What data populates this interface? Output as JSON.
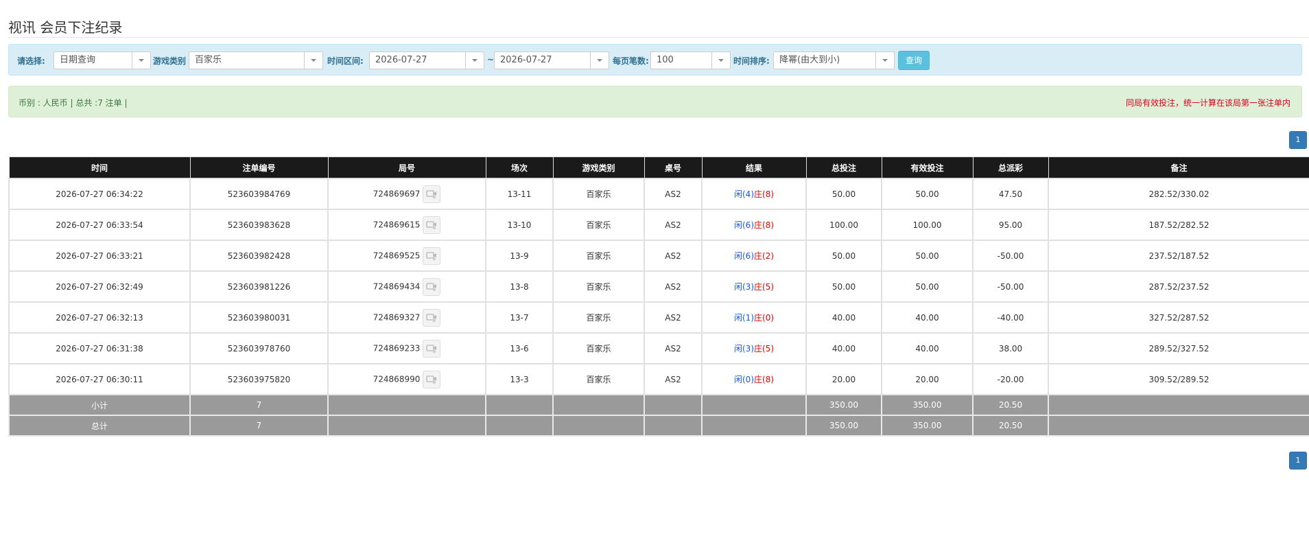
{
  "page": {
    "title": "视讯 会员下注纪录"
  },
  "filters": {
    "select_label": "请选择:",
    "select_value": "日期查询",
    "game_type_label": "游戏类别",
    "game_type_value": "百家乐",
    "time_range_label": "时间区间:",
    "date_from": "2026-07-27",
    "tilde": "~",
    "date_to": "2026-07-27",
    "per_page_label": "每页笔数:",
    "per_page_value": "100",
    "sort_label": "时间排序:",
    "sort_value": "降幂(由大到小)",
    "query_button": "查询"
  },
  "summary": {
    "left": "币别 : 人民币 | 总共 :7 注单 |",
    "right": "同局有效投注，统一计算在该局第一张注单内"
  },
  "pagination": {
    "current": "1"
  },
  "table": {
    "headers": [
      "时间",
      "注单编号",
      "局号",
      "场次",
      "游戏类别",
      "桌号",
      "结果",
      "总投注",
      "有效投注",
      "总派彩",
      "备注"
    ],
    "rows": [
      {
        "time": "2026-07-27 06:34:22",
        "bet_id": "523603984769",
        "round": "724869697",
        "shoe": "13-11",
        "game": "百家乐",
        "table": "AS2",
        "xian": "闲",
        "xian_pts": "(4)",
        "zhuang": "庄",
        "zhuang_pts": "(8)",
        "total_bet": "50.00",
        "valid_bet": "50.00",
        "payout": "47.50",
        "payout_color": "normal",
        "note": "282.52/330.02"
      },
      {
        "time": "2026-07-27 06:33:54",
        "bet_id": "523603983628",
        "round": "724869615",
        "shoe": "13-10",
        "game": "百家乐",
        "table": "AS2",
        "xian": "闲",
        "xian_pts": "(6)",
        "zhuang": "庄",
        "zhuang_pts": "(8)",
        "total_bet": "100.00",
        "valid_bet": "100.00",
        "payout": "95.00",
        "payout_color": "normal",
        "note": "187.52/282.52"
      },
      {
        "time": "2026-07-27 06:33:21",
        "bet_id": "523603982428",
        "round": "724869525",
        "shoe": "13-9",
        "game": "百家乐",
        "table": "AS2",
        "xian": "闲",
        "xian_pts": "(6)",
        "zhuang": "庄",
        "zhuang_pts": "(2)",
        "total_bet": "50.00",
        "valid_bet": "50.00",
        "payout": "-50.00",
        "payout_color": "red",
        "note": "237.52/187.52"
      },
      {
        "time": "2026-07-27 06:32:49",
        "bet_id": "523603981226",
        "round": "724869434",
        "shoe": "13-8",
        "game": "百家乐",
        "table": "AS2",
        "xian": "闲",
        "xian_pts": "(3)",
        "zhuang": "庄",
        "zhuang_pts": "(5)",
        "total_bet": "50.00",
        "valid_bet": "50.00",
        "payout": "-50.00",
        "payout_color": "red",
        "note": "287.52/237.52"
      },
      {
        "time": "2026-07-27 06:32:13",
        "bet_id": "523603980031",
        "round": "724869327",
        "shoe": "13-7",
        "game": "百家乐",
        "table": "AS2",
        "xian": "闲",
        "xian_pts": "(1)",
        "zhuang": "庄",
        "zhuang_pts": "(0)",
        "total_bet": "40.00",
        "valid_bet": "40.00",
        "payout": "-40.00",
        "payout_color": "red",
        "note": "327.52/287.52"
      },
      {
        "time": "2026-07-27 06:31:38",
        "bet_id": "523603978760",
        "round": "724869233",
        "shoe": "13-6",
        "game": "百家乐",
        "table": "AS2",
        "xian": "闲",
        "xian_pts": "(3)",
        "zhuang": "庄",
        "zhuang_pts": "(5)",
        "total_bet": "40.00",
        "valid_bet": "40.00",
        "payout": "38.00",
        "payout_color": "normal",
        "note": "289.52/327.52"
      },
      {
        "time": "2026-07-27 06:30:11",
        "bet_id": "523603975820",
        "round": "724868990",
        "shoe": "13-3",
        "game": "百家乐",
        "table": "AS2",
        "xian": "闲",
        "xian_pts": "(0)",
        "zhuang": "庄",
        "zhuang_pts": "(8)",
        "total_bet": "20.00",
        "valid_bet": "20.00",
        "payout": "-20.00",
        "payout_color": "red",
        "note": "309.52/289.52"
      }
    ],
    "subtotal": {
      "label": "小计",
      "count": "7",
      "total_bet": "350.00",
      "valid_bet": "350.00",
      "payout": "20.50"
    },
    "total": {
      "label": "总计",
      "count": "7",
      "total_bet": "350.00",
      "valid_bet": "350.00",
      "payout": "20.50"
    }
  },
  "icons": {
    "replay": "video-replay-icon",
    "dropdown": "chevron-down-icon"
  },
  "colors": {
    "header_bg": "#1a1a1a",
    "sum_row_bg": "#9a9a9a",
    "filter_bg": "#d9edf7",
    "summary_bg": "#dff0d8",
    "accent": "#337ab7",
    "query_button": "#5bc0de",
    "positive_blue": "#1a56db",
    "negative_red": "#e00000"
  }
}
